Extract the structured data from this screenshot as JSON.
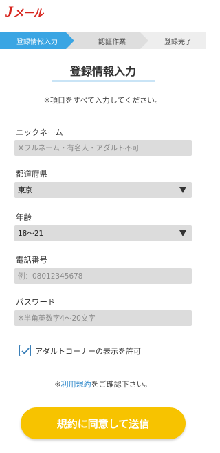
{
  "header": {
    "logo_j": "J",
    "logo_rest": "メール",
    "brand_color": "#d7241d"
  },
  "steps": [
    "登録情報入力",
    "認証作業",
    "登録完了"
  ],
  "title": "登録情報入力",
  "note": "※項目をすべて入力してください。",
  "fields": {
    "nickname": {
      "label": "ニックネーム",
      "placeholder": "※フルネーム・有名人・アダルト不可"
    },
    "prefecture": {
      "label": "都道府県",
      "value": "東京"
    },
    "age": {
      "label": "年齢",
      "value": "18〜21"
    },
    "phone": {
      "label": "電話番号",
      "placeholder": "例：08012345678"
    },
    "password": {
      "label": "パスワード",
      "placeholder": "※半角英数字4〜20文字"
    }
  },
  "adult_checkbox": {
    "label": "アダルトコーナーの表示を許可",
    "checked": true
  },
  "terms": {
    "prefix": "※",
    "link": "利用規約",
    "suffix": "をご確認下さい。"
  },
  "submit_label": "規約に同意して送信",
  "colors": {
    "accent": "#3aa5e3",
    "button": "#f7c300"
  }
}
